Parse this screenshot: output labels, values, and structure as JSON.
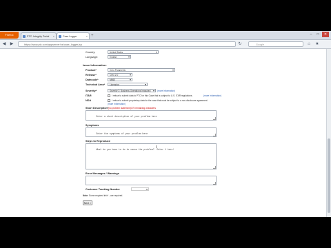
{
  "browser": {
    "firefox_label": "Firefox",
    "tabs": [
      {
        "label": "PTC: Integrity Portal"
      },
      {
        "label": "Case Logger"
      }
    ],
    "new_tab": "+",
    "url": "https://www.ptc.com/appserver/cs/case_logger.jsp",
    "search_placeholder": "Google",
    "window_controls": {
      "minimize": "–",
      "maximize": "□",
      "close": "✕"
    }
  },
  "form": {
    "country_label": "Country:",
    "country_value": "United States",
    "language_label": "Language:",
    "language_value": "English",
    "issue_section": "Issue Information:",
    "product_label": "Product*",
    "product_value": "Creo Parametric",
    "release_label": "Release*",
    "release_value": "Creo 2.0",
    "datecode_label": "Datecode*",
    "datecode_value": "M060",
    "technical_area_label": "Technical Area*",
    "technical_area_value": "Licensing",
    "severity_label": "Severity*",
    "severity_value": "Severity 3: Business Operations Impacted",
    "severity_help": "(more information)",
    "itar_label": "ITAR",
    "itar_text": "I refuse to submit data to PTC for this Case that is subject to U.S. ITAR regulations.",
    "itar_link": "(more information)",
    "nda_label": "NDA",
    "nda_text": "I refuse to submit proprietary data for the case that must be subject to a non-disclosure agreement.",
    "nda_link": "(more information)",
    "short_desc_label": "Short Description*",
    "short_desc_help": "(no problem statement)",
    "short_desc_remaining": "175 remaining characters",
    "short_desc_value": "Enter a short description of your problem here",
    "symptoms_label": "Symptoms",
    "symptoms_value": "Enter the symptoms of your problem here",
    "steps_label": "Steps to Reproduce",
    "steps_value": "What do you have to do to cause the problem?  Enter 1 here!",
    "errors_label": "Error Messages / Warnings",
    "customer_tracking_label": "Customer Tracking Number",
    "note_label": "Note:",
    "note_text": "Some required info* - are required.",
    "next_button": "Next >"
  }
}
